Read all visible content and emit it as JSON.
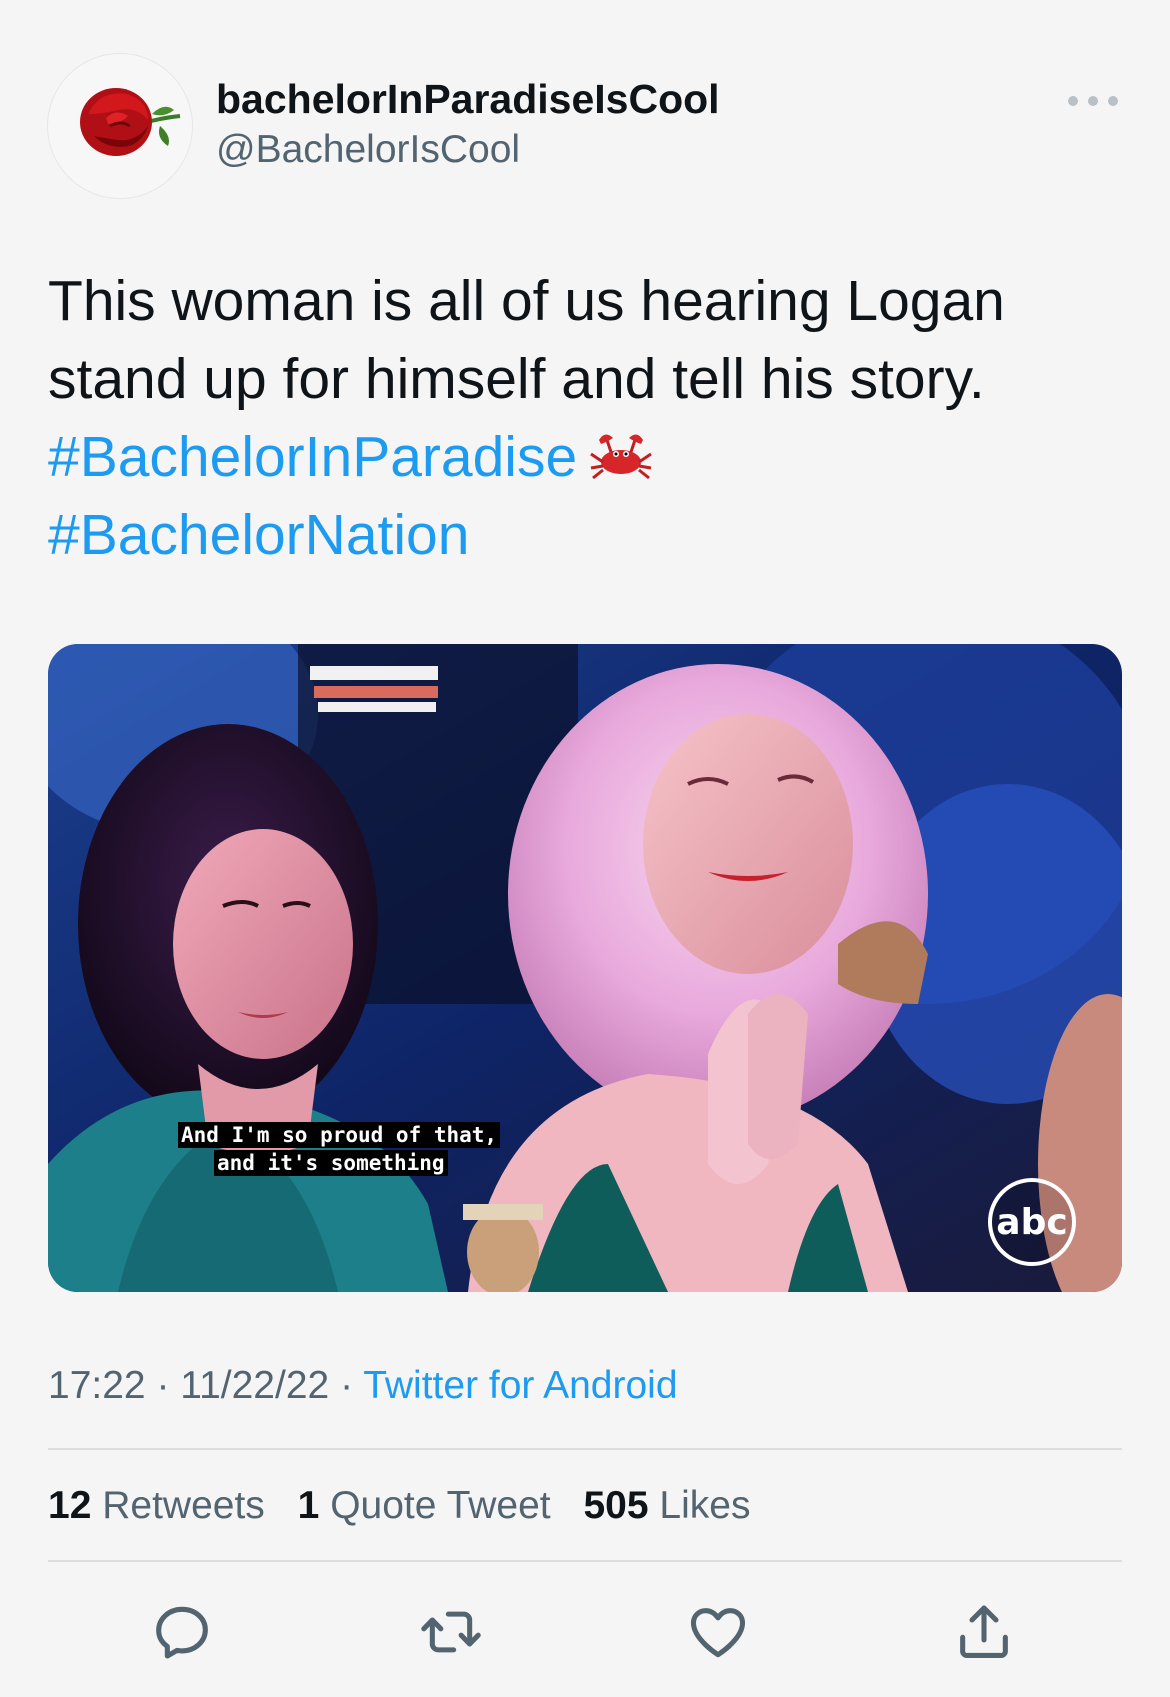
{
  "user": {
    "display_name": "bachelorInParadiseIsCool",
    "handle": "@BachelorIsCool",
    "avatar_icon": "rose-icon"
  },
  "tweet": {
    "text_line1": "This woman is all of us hearing Logan",
    "text_line2": "stand up for himself and tell his story.",
    "hashtag1": "#BachelorInParadise",
    "hashtag1_emoji": "crab-icon",
    "hashtag2": "#BachelorNation"
  },
  "media": {
    "caption_line1": "And I'm so proud of that,",
    "caption_line2": "and it's something",
    "network_logo": "abc"
  },
  "meta": {
    "time": "17:22",
    "separator": "·",
    "date": "11/22/22",
    "source": "Twitter for Android"
  },
  "stats": {
    "retweets_count": "12",
    "retweets_label": "Retweets",
    "quotes_count": "1",
    "quotes_label": "Quote Tweet",
    "likes_count": "505",
    "likes_label": "Likes"
  },
  "colors": {
    "link": "#1d9bf0",
    "secondary_text": "#536471",
    "primary_text": "#0f1419"
  },
  "actions": [
    "reply-icon",
    "retweet-icon",
    "like-icon",
    "share-icon"
  ]
}
